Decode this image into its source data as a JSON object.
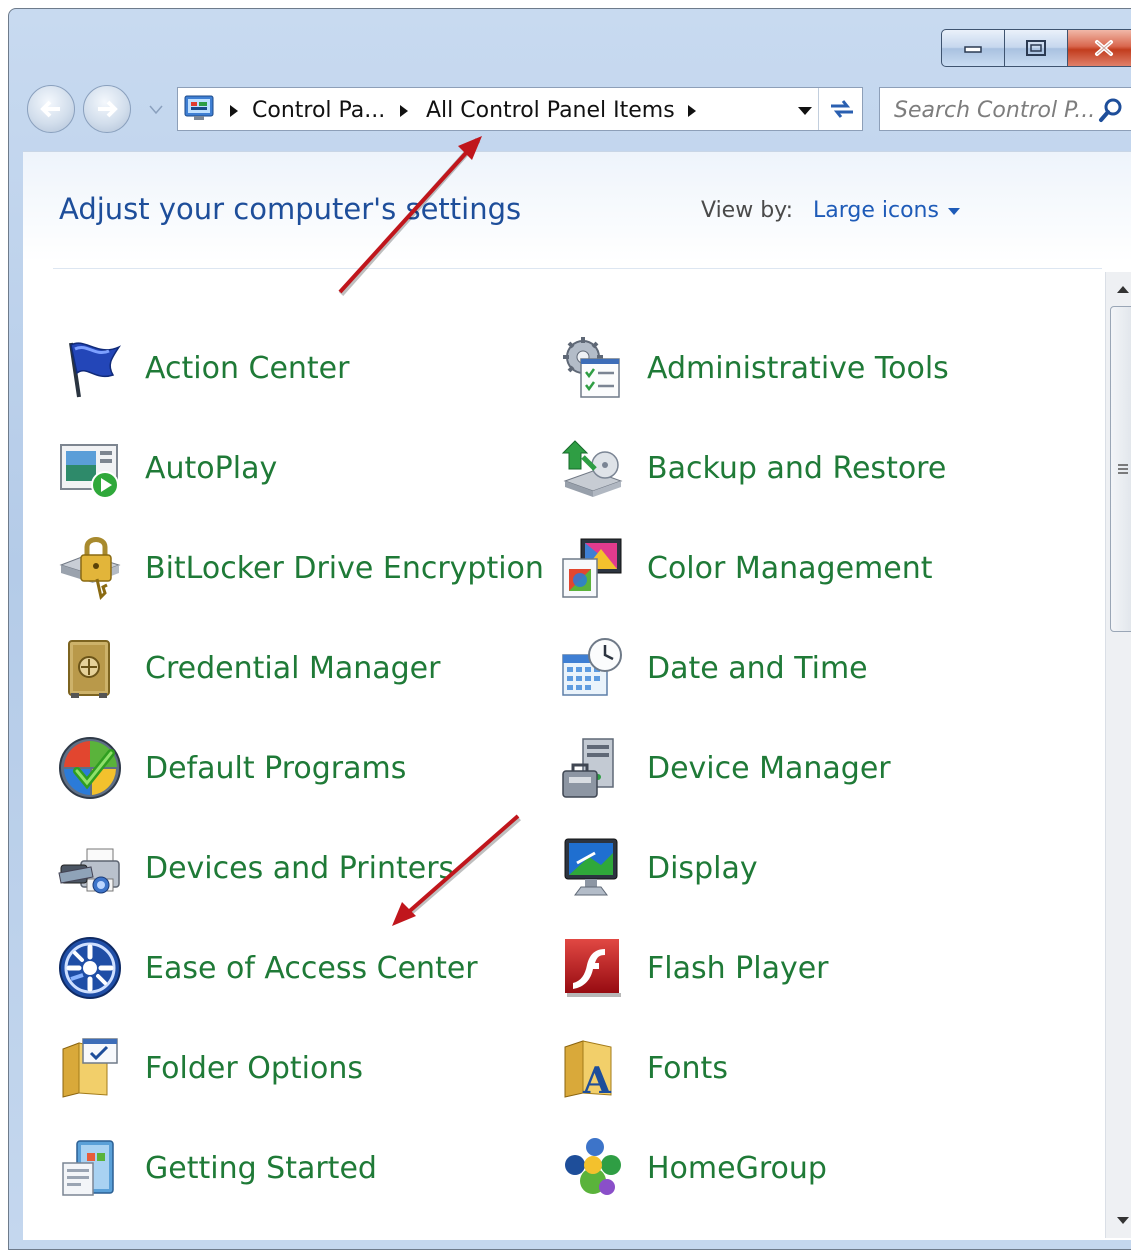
{
  "window": {
    "caption_buttons": [
      "minimize-icon",
      "maximize-icon",
      "close-icon"
    ],
    "accent": "#c23d1e"
  },
  "address_bar": {
    "crumbs": [
      "Control Pa...",
      "All Control Panel Items"
    ]
  },
  "search": {
    "placeholder": "Search Control P..."
  },
  "content": {
    "heading": "Adjust your computer's settings",
    "view_by_label": "View by:",
    "view_by_value": "Large icons"
  },
  "items_left": [
    {
      "label": "Action Center",
      "icon": "flag-icon"
    },
    {
      "label": "AutoPlay",
      "icon": "autoplay-icon"
    },
    {
      "label": "BitLocker Drive Encryption",
      "icon": "lock-drive-icon"
    },
    {
      "label": "Credential Manager",
      "icon": "vault-icon"
    },
    {
      "label": "Default Programs",
      "icon": "windows-check-icon"
    },
    {
      "label": "Devices and Printers",
      "icon": "printer-icon"
    },
    {
      "label": "Ease of Access Center",
      "icon": "accessibility-icon"
    },
    {
      "label": "Folder Options",
      "icon": "folder-options-icon"
    },
    {
      "label": "Getting Started",
      "icon": "getting-started-icon"
    }
  ],
  "items_right": [
    {
      "label": "Administrative Tools",
      "icon": "admin-tools-icon"
    },
    {
      "label": "Backup and Restore",
      "icon": "backup-icon"
    },
    {
      "label": "Color Management",
      "icon": "color-management-icon"
    },
    {
      "label": "Date and Time",
      "icon": "calendar-clock-icon"
    },
    {
      "label": "Device Manager",
      "icon": "device-manager-icon"
    },
    {
      "label": "Display",
      "icon": "monitor-icon"
    },
    {
      "label": "Flash Player",
      "icon": "flash-icon"
    },
    {
      "label": "Fonts",
      "icon": "fonts-folder-icon"
    },
    {
      "label": "HomeGroup",
      "icon": "homegroup-icon"
    }
  ],
  "colors": {
    "item_text": "#1f7a37",
    "heading": "#1e4e9a",
    "link": "#1e5bb8",
    "annotation_arrow": "#c0161c"
  }
}
